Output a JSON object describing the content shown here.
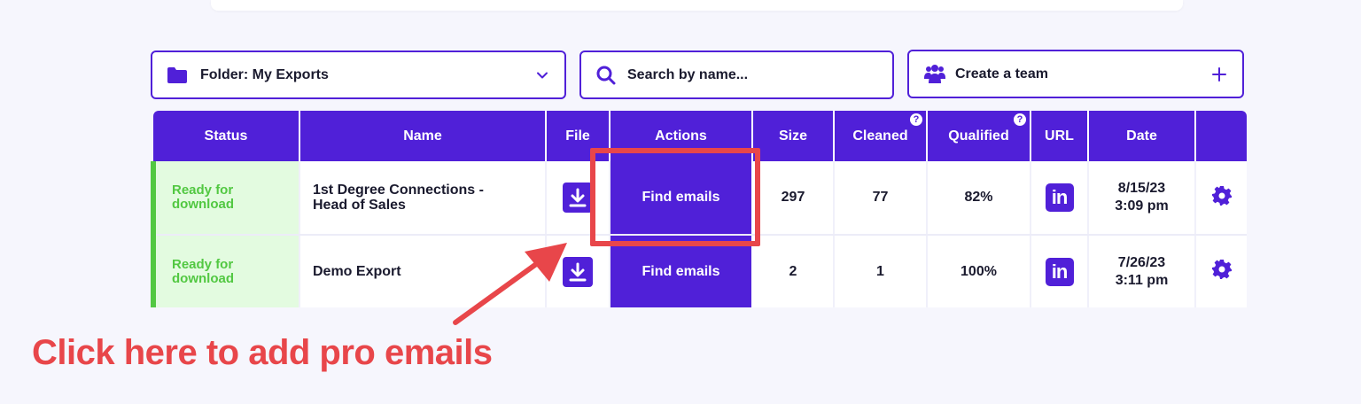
{
  "toolbar": {
    "folder_label": "Folder: My Exports",
    "search_placeholder": "Search by name...",
    "team_label": "Create a team"
  },
  "table": {
    "headers": {
      "status": "Status",
      "name": "Name",
      "file": "File",
      "actions": "Actions",
      "size": "Size",
      "cleaned": "Cleaned",
      "qualified": "Qualified",
      "url": "URL",
      "date": "Date"
    },
    "help_glyph": "?",
    "linkedin_glyph": "in",
    "rows": [
      {
        "status_line1": "Ready for",
        "status_line2": "download",
        "name_line1": "1st Degree Connections -",
        "name_line2": "Head of Sales",
        "action": "Find emails",
        "size": "297",
        "cleaned": "77",
        "qualified": "82%",
        "date_line1": "8/15/23",
        "date_line2": "3:09 pm"
      },
      {
        "status_line1": "Ready for",
        "status_line2": "download",
        "name_line1": "Demo Export",
        "action": "Find emails",
        "size": "2",
        "cleaned": "1",
        "qualified": "100%",
        "date_line1": "7/26/23",
        "date_line2": "3:11 pm"
      }
    ]
  },
  "annotation": {
    "callout": "Click here to add pro emails"
  },
  "colors": {
    "brand": "#5020d8",
    "status_green": "#52c842",
    "status_bg": "#e3fbe0",
    "annotation_red": "#e8464a"
  },
  "icons": [
    "folder-icon",
    "chevron-down-icon",
    "search-icon",
    "team-icon",
    "plus-icon",
    "help-icon",
    "download-icon",
    "linkedin-icon",
    "gear-icon"
  ]
}
